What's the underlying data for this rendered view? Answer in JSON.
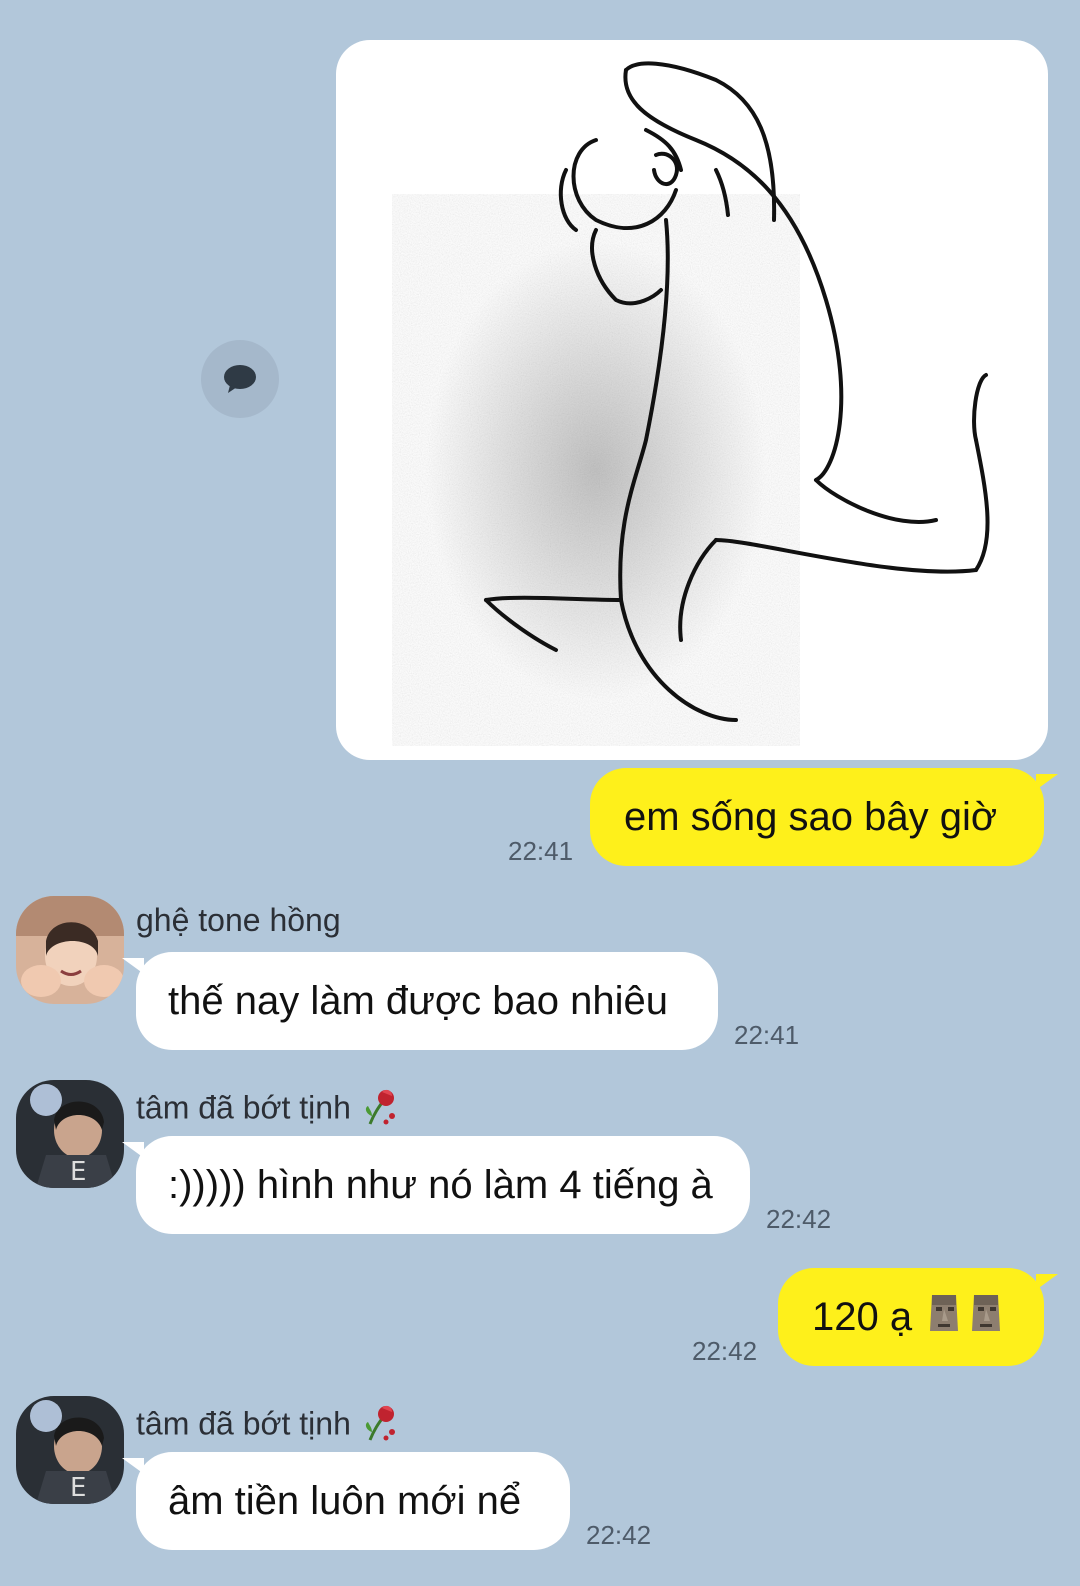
{
  "messages": [
    {
      "type": "image",
      "from": "me",
      "icon": "stick-figure-drawing"
    },
    {
      "type": "text",
      "from": "me",
      "text": "em sống sao bây giờ",
      "time": "22:41"
    },
    {
      "type": "text",
      "from": "them",
      "sender": "ghệ tone hồng",
      "text": "thế nay làm được bao nhiêu",
      "time": "22:41"
    },
    {
      "type": "text",
      "from": "them",
      "sender": "tâm đã bớt tịnh",
      "sender_emoji": "wilted-rose-icon",
      "text": ":))))) hình như nó làm 4 tiếng à",
      "time": "22:42"
    },
    {
      "type": "text",
      "from": "me",
      "text": "120 ạ",
      "emojis": [
        "moai-icon",
        "moai-icon"
      ],
      "time": "22:42"
    },
    {
      "type": "text",
      "from": "them",
      "sender": "tâm đã bớt tịnh",
      "sender_emoji": "wilted-rose-icon",
      "text": "âm tiền luôn mới nể",
      "time": "22:42"
    }
  ],
  "colors": {
    "background": "#b2c7da",
    "my_bubble": "#fef01b",
    "their_bubble": "#ffffff",
    "time_text": "#4e5b69"
  }
}
